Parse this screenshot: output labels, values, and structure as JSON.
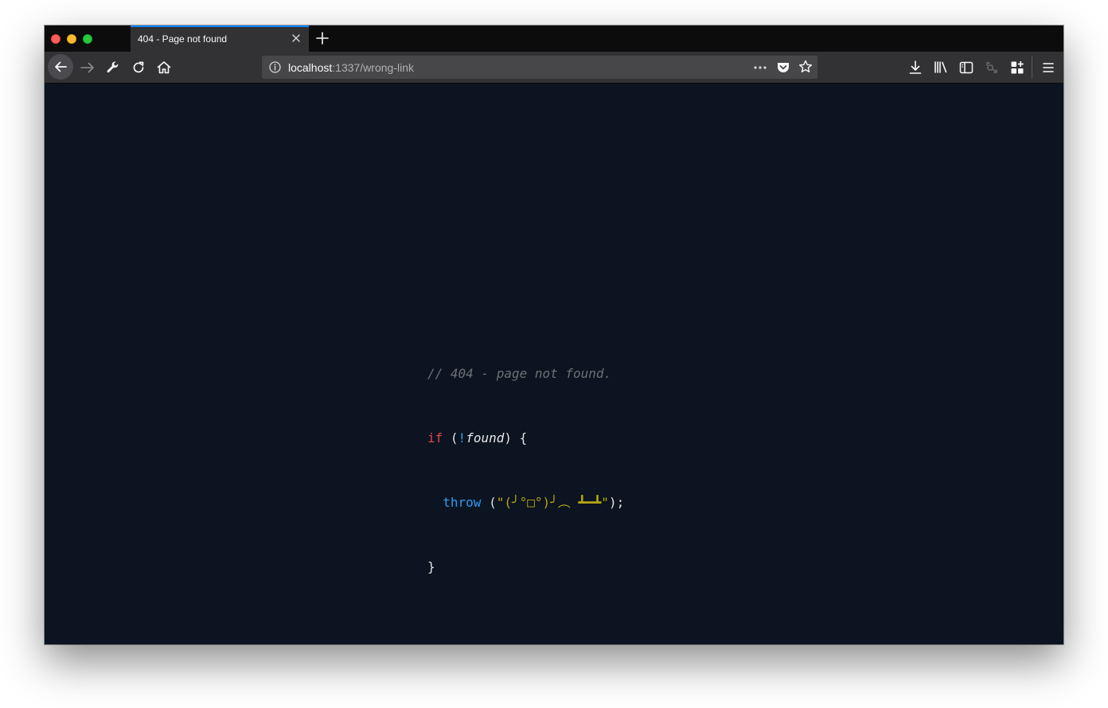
{
  "tab": {
    "title": "404 - Page not found"
  },
  "urlbar": {
    "host": "localhost",
    "path": ":1337/wrong-link"
  },
  "page": {
    "comment": "// 404 - page not found.",
    "if_keyword": "if",
    "paren_open": "(",
    "not_operator": "!",
    "found_var": "found",
    "paren_close_brace": ") {",
    "indent": "  ",
    "throw_keyword": "throw",
    "throw_open": " (",
    "thrown_string": "\"(╯°□°)╯︵ ┻━┻\"",
    "throw_close": ");",
    "close_brace": "}"
  },
  "colors": {
    "background": "#0b1420",
    "keyword_if": "#e0474c",
    "keyword_throw": "#2d9cf5",
    "string": "#b7a514",
    "comment": "#6b7176",
    "tab_accent": "#0a84ff"
  },
  "icons": {
    "back": "back-arrow-icon",
    "forward": "forward-arrow-icon",
    "tools": "wrench-icon",
    "reload": "reload-icon",
    "home": "home-icon",
    "info": "info-icon",
    "page_actions": "more-dots-icon",
    "pocket": "pocket-icon",
    "bookmark": "star-icon",
    "downloads": "download-icon",
    "library": "library-icon",
    "sidebar": "sidebar-icon",
    "screenshot": "screenshot-icon",
    "extensions": "grid-add-icon",
    "menu": "hamburger-menu-icon"
  }
}
